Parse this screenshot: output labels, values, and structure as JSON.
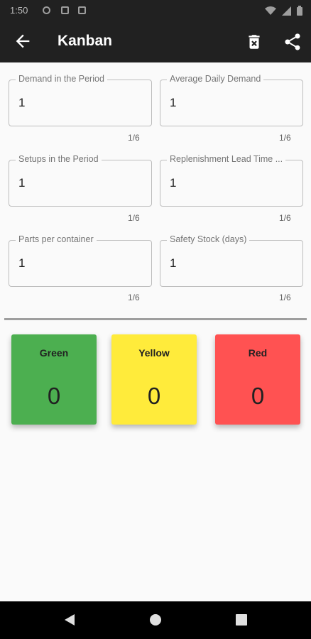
{
  "status_bar": {
    "time": "1:50"
  },
  "app_bar": {
    "title": "Kanban",
    "back_icon": "arrow-back-icon",
    "delete_icon": "delete-icon",
    "share_icon": "share-icon"
  },
  "fields": [
    {
      "label": "Demand in the Period",
      "value": "1",
      "counter": "1/6"
    },
    {
      "label": "Average Daily Demand",
      "value": "1",
      "counter": "1/6"
    },
    {
      "label": "Setups in the Period",
      "value": "1",
      "counter": "1/6"
    },
    {
      "label": "Replenishment Lead Time ...",
      "value": "1",
      "counter": "1/6"
    },
    {
      "label": "Parts per container",
      "value": "1",
      "counter": "1/6"
    },
    {
      "label": "Safety Stock (days)",
      "value": "1",
      "counter": "1/6"
    }
  ],
  "cards": [
    {
      "label": "Green",
      "value": "0",
      "color": "#4caf50"
    },
    {
      "label": "Yellow",
      "value": "0",
      "color": "#ffeb3b"
    },
    {
      "label": "Red",
      "value": "0",
      "color": "#ff5252"
    }
  ],
  "nav_bar": {
    "back_icon": "nav-back-icon",
    "home_icon": "nav-home-icon",
    "recents_icon": "nav-recents-icon"
  }
}
